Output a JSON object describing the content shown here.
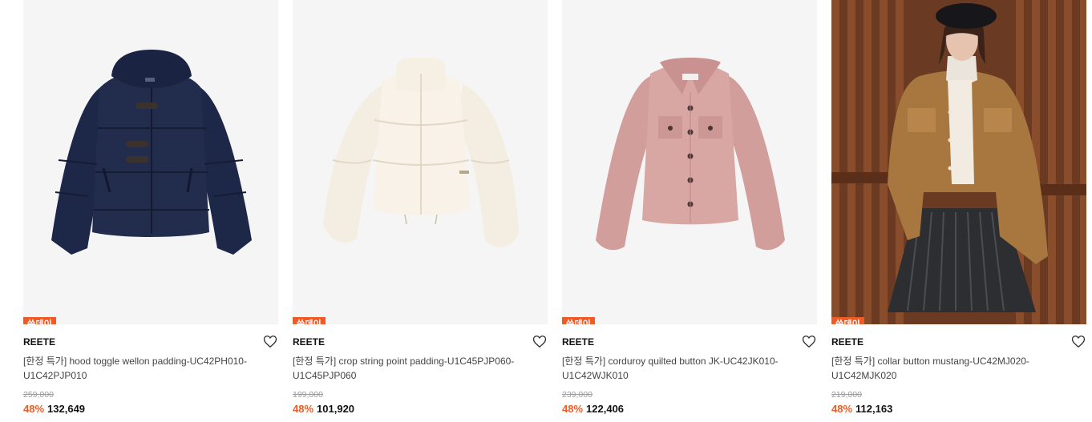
{
  "products": [
    {
      "badge": "쓱데이",
      "brand": "REETE",
      "title": "[한정 특가] hood toggle wellon padding-UC42PH010-U1C42PJP010",
      "original_price": "259,000",
      "discount": "48%",
      "price": "132,649",
      "image_icon": "navy-hooded-padded-jacket-image"
    },
    {
      "badge": "쓱데이",
      "brand": "REETE",
      "title": "[한정 특가] crop string point padding-U1C45PJP060-U1C45PJP060",
      "original_price": "199,000",
      "discount": "48%",
      "price": "101,920",
      "image_icon": "cream-cropped-puffer-image"
    },
    {
      "badge": "쓱데이",
      "brand": "REETE",
      "title": "[한정 특가] corduroy quilted button JK-UC42JK010-U1C42WJK010",
      "original_price": "239,000",
      "discount": "48%",
      "price": "122,406",
      "image_icon": "pink-corduroy-jacket-image"
    },
    {
      "badge": "쓱데이",
      "brand": "REETE",
      "title": "[한정 특가] collar button mustang-UC42MJ020-U1C42MJK020",
      "original_price": "219,000",
      "discount": "48%",
      "price": "112,163",
      "image_icon": "model-mustang-jacket-photo"
    }
  ],
  "colors": {
    "accent": "#f15a24",
    "text": "#111111",
    "muted": "#9a9a9a"
  }
}
